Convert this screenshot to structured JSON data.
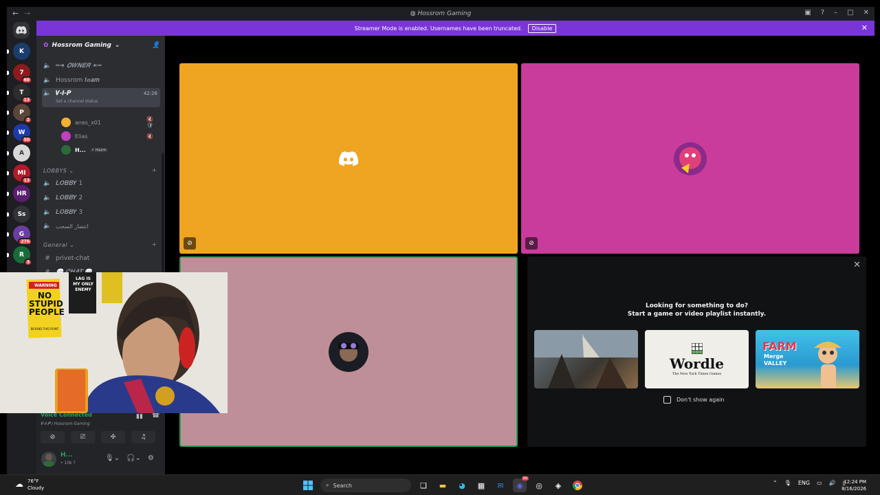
{
  "window": {
    "title": "Hossrom Gaming",
    "back": "←",
    "forward": "→"
  },
  "banner": {
    "text": "Streamer Mode is enabled. Usernames have been truncated.",
    "button": "Disable"
  },
  "servers": [
    {
      "label": "K",
      "color": "#1a3d6e",
      "badge": ""
    },
    {
      "label": "7",
      "color": "#8a1c1c",
      "badge": "60"
    },
    {
      "label": "T",
      "color": "#2d2d2d",
      "badge": "13"
    },
    {
      "label": "P",
      "color": "#5a4638",
      "badge": "2"
    },
    {
      "label": "W",
      "color": "#1f3aa8",
      "badge": "50"
    },
    {
      "label": "A",
      "color": "#d8d8d8",
      "badge": ""
    },
    {
      "label": "MI",
      "color": "#b01a2a",
      "badge": "13"
    },
    {
      "label": "HR",
      "color": "#5a1f6e",
      "badge": ""
    },
    {
      "label": "Ss",
      "color": "#313338",
      "badge": ""
    },
    {
      "label": "G",
      "color": "#6b3fa0",
      "badge": "276"
    },
    {
      "label": "R",
      "color": "#1a6b3a",
      "badge": "3"
    }
  ],
  "sidebar": {
    "server_name": "Hossrom Gaming",
    "channels_top": [
      {
        "name": "═➜ 𝑶𝑾𝑵𝑬𝑹 ☙═",
        "type": "voice"
      },
      {
        "name": "Hossrom 𝒕𝒆𝒂𝒎",
        "type": "voice"
      }
    ],
    "active_channel": {
      "name": "𝑽-𝑰-𝑷",
      "time": "42:26",
      "status": "Set a channel status"
    },
    "members": [
      {
        "name": "anes_x01",
        "color": "#f0b232"
      },
      {
        "name": "Elias",
        "color": "#c040c0"
      },
      {
        "name": "H...",
        "tag": "⚡ Hsrm",
        "color": "#2b6b3a"
      }
    ],
    "categories": [
      {
        "name": "LOBBYS"
      },
      {
        "name": "General"
      }
    ],
    "lobbys": [
      "𝑳𝑶𝑩𝑩𝒀 1",
      "𝑳𝑶𝑩𝑩𝒀 2",
      "𝑳𝑶𝑩𝑩𝒀 3",
      "انتضار السحب"
    ],
    "text_channels": [
      "privet-chat",
      "💬 𝑪𝑯𝑨𝑻 💬"
    ]
  },
  "voice": {
    "status": "Voice Connected",
    "location": "𝑽-𝑰-𝑷 / Hossrom Gaming"
  },
  "user": {
    "name": "H...",
    "status": "• 10k ?"
  },
  "activity": {
    "line1": "Looking for something to do?",
    "line2": "Start a game or video playlist instantly.",
    "cards": [
      {
        "title": "",
        "color": "#4e5a64"
      },
      {
        "title": "Wordle",
        "sub": "The New York Times Games",
        "color": "#f0efe9"
      },
      {
        "title": "FARM",
        "sub": "Merge VALLEY",
        "color": "#2fb0d6"
      }
    ],
    "dont_show": "Don't show again"
  },
  "webcam": {
    "sign1": "NO STUPID PEOPLE",
    "sign1_sub": "BEYOND THIS POINT",
    "sign1_top": "WARNING",
    "sign2": "LAG IS MY ONLY ENEMY"
  },
  "taskbar": {
    "temp": "76°F",
    "weather": "Cloudy",
    "search": "Search",
    "lang": "ENG",
    "time": "12:24 PM",
    "date": "8/16/2026",
    "discord_badge": "99"
  }
}
